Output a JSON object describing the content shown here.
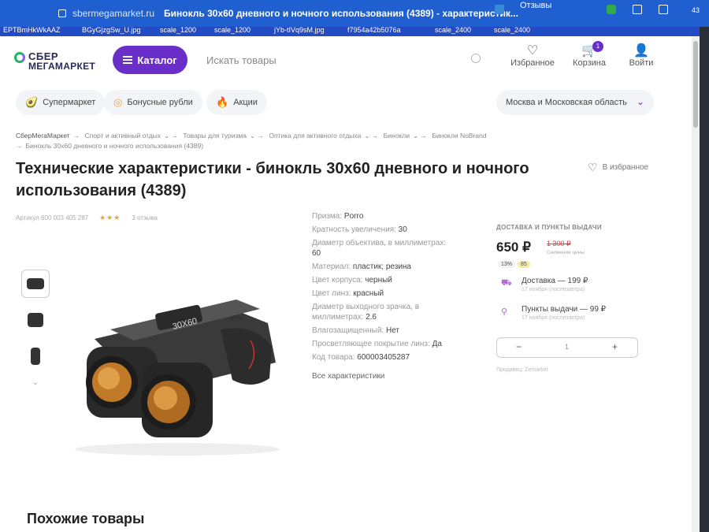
{
  "browser": {
    "url": "sbermegamarket.ru",
    "tab_title": "Бинокль 30х60 дневного и ночного использования (4389) - характеристик...",
    "reviews_label": "Отзывы",
    "clock": "43",
    "bookmarks": [
      "EPTBmHkWkAAZ",
      "BGyGjzgSw_U.jpg",
      "scale_1200",
      "scale_1200",
      "jYb-tIVq9sM.jpg",
      "f7954a42b5076a",
      "scale_2400",
      "scale_2400"
    ]
  },
  "header": {
    "logo_line1": "СБЕР",
    "logo_line2": "МЕГАМАРКЕТ",
    "catalog_label": "Каталог",
    "search_placeholder": "Искать товары",
    "favorites_label": "Избранное",
    "cart_label": "Корзина",
    "cart_count": "1",
    "login_label": "Войти"
  },
  "subnav": {
    "items": [
      {
        "label": "Супермаркет",
        "icon": "avocado-icon"
      },
      {
        "label": "Бонусные рубли",
        "icon": "coin-icon"
      },
      {
        "label": "Акции",
        "icon": "fire-icon"
      }
    ],
    "region": "Москва и Московская область"
  },
  "breadcrumbs": [
    "СберМегаМаркет",
    "Спорт и активный отдых",
    "Товары для туризма",
    "Оптика для активного отдыха",
    "Бинокли",
    "Бинокли NoBrand",
    "Бинокль 30х60 дневного и ночного использования (4389)"
  ],
  "product": {
    "title": "Технические характеристики - бинокль 30х60 дневного и ночного использования (4389)",
    "favorite_label": "В избранное",
    "article": "Артикул 600 003 405 287",
    "rating_stars": 3,
    "reviews": "3 отзыва",
    "lens_label": "30X60"
  },
  "specs": [
    {
      "label": "Призма:",
      "value": "Porro"
    },
    {
      "label": "Кратность увеличения:",
      "value": "30"
    },
    {
      "label": "Диаметр объектива, в миллиметрах:",
      "value": "60"
    },
    {
      "label": "Материал:",
      "value": "пластик; резина"
    },
    {
      "label": "Цвет корпуса:",
      "value": "черный"
    },
    {
      "label": "Цвет линз:",
      "value": "красный"
    },
    {
      "label": "Диаметр выходного зрачка, в миллиметрах:",
      "value": "2.6"
    },
    {
      "label": "Влагозащищенный:",
      "value": "Нет"
    },
    {
      "label": "Просветляющее покрытие линз:",
      "value": "Да"
    },
    {
      "label": "Код товара:",
      "value": "600003405287"
    }
  ],
  "all_specs_link": "Все характеристики",
  "buybox": {
    "heading": "ДОСТАВКА И ПУНКТЫ ВЫДАЧИ",
    "price": "650 ₽",
    "old_price": "1 300 ₽",
    "price_note": "Снижение цены",
    "discount": "13%",
    "bonus": "85",
    "delivery_label": "Доставка — 199 ₽",
    "delivery_date": "17 ноября (послезавтра)",
    "pickup_label": "Пункты выдачи — 99 ₽",
    "pickup_date": "17 ноября (послезавтра)",
    "quantity": "1",
    "seller": "Продавец: Zemarket"
  },
  "similar_heading": "Похожие товары"
}
